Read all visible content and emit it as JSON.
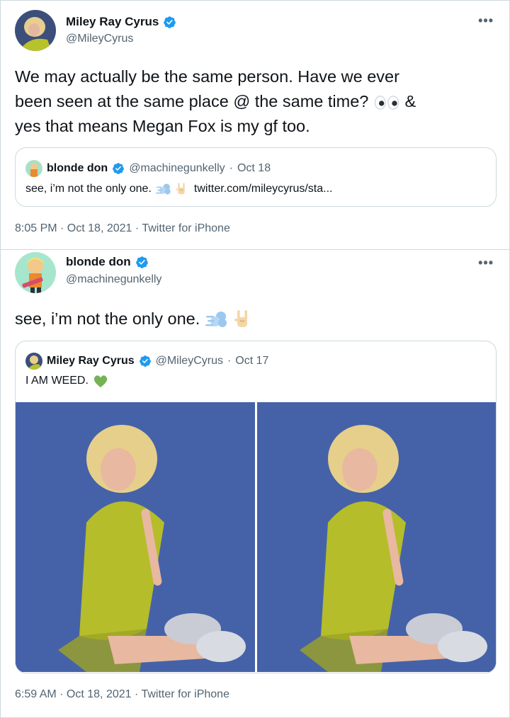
{
  "tweet1": {
    "author_name": "Miley Ray Cyrus",
    "author_handle": "@MileyCyrus",
    "more_icon": "more-horizontal-icon",
    "text_line1": "We may actually be the same person. Have we ever",
    "text_line2": "been seen at the same place @ the same time?",
    "text_line2_end": "&",
    "text_line3": "yes that means Megan Fox is my gf too.",
    "quote": {
      "author_name": "blonde don",
      "author_handle": "@machinegunkelly",
      "sep": "·",
      "date": "Oct 18",
      "text": "see, i’m not the only one.",
      "link": "twitter.com/mileycyrus/sta..."
    },
    "timestamp": "8:05 PM · Oct 18, 2021 · Twitter for iPhone"
  },
  "tweet2": {
    "author_name": "blonde don",
    "author_handle": "@machinegunkelly",
    "more_icon": "more-horizontal-icon",
    "text": "see, i’m not the only one.",
    "quote": {
      "author_name": "Miley Ray Cyrus",
      "author_handle": "@MileyCyrus",
      "sep": "·",
      "date": "Oct 17",
      "text": "I AM WEED."
    },
    "timestamp": "6:59 AM · Oct 18, 2021 · Twitter for iPhone"
  },
  "colors": {
    "verified_blue": "#1d9bf0",
    "secondary_text": "#536471",
    "border": "#cfd9de",
    "photo_background": "#3d5aa0",
    "dress_green": "#b5bd2a"
  }
}
